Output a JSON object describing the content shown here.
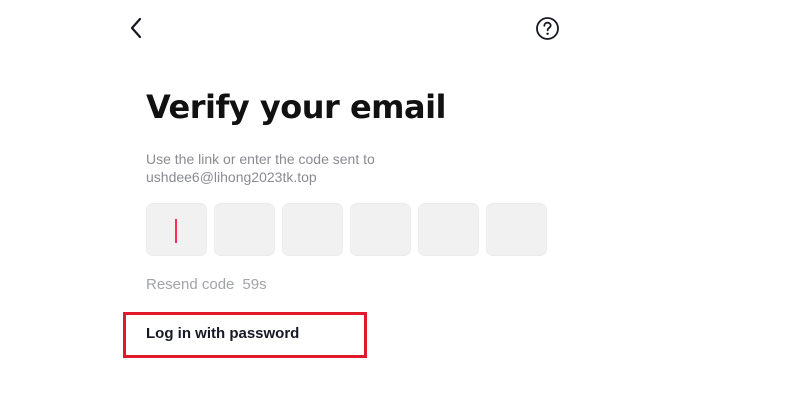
{
  "header": {
    "back_icon": "chevron-left-icon",
    "help_icon": "question-circle-icon"
  },
  "main": {
    "title": "Verify your email",
    "subtitle_line1": "Use the link or enter the code sent to",
    "email": "ushdee6@lihong2023tk.top",
    "code_digits": [
      "",
      "",
      "",
      "",
      "",
      ""
    ],
    "resend_label": "Resend code",
    "resend_timer": "59s",
    "login_password_label": "Log in with password"
  },
  "colors": {
    "caret": "#fe2c55",
    "highlight": "#e0192b",
    "box_bg": "#f1f1f2"
  }
}
